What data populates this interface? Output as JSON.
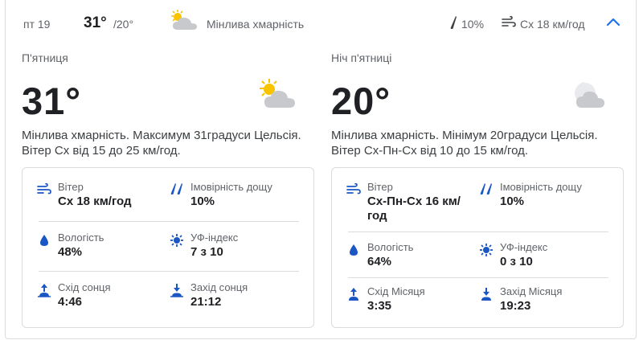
{
  "summary": {
    "day": "пт 19",
    "high": "31°",
    "low": "/20°",
    "condition": "Мінлива хмарність",
    "rain": "10%",
    "wind": "Сх 18 км/год"
  },
  "day": {
    "label": "П'ятниця",
    "temp": "31°",
    "description": "Мінлива хмарність. Максимум 31градуси Цельсія. Вітер Сх від 15 до 25 км/год.",
    "details": {
      "wind_label": "Вітер",
      "wind_value": "Сх 18 км/год",
      "rain_label": "Імовірність дощу",
      "rain_value": "10%",
      "humidity_label": "Вологість",
      "humidity_value": "48%",
      "uv_label": "УФ-індекс",
      "uv_value": "7 з 10",
      "rise_label": "Схід сонця",
      "rise_value": "4:46",
      "set_label": "Захід сонця",
      "set_value": "21:12"
    }
  },
  "night": {
    "label": "Ніч п'ятниці",
    "temp": "20°",
    "description": "Мінлива хмарність. Мінімум 20градуси Цельсія. Вітер Сх-Пн-Сх від 10 до 15 км/год.",
    "details": {
      "wind_label": "Вітер",
      "wind_value": "Сх-Пн-Сх 16 км/год",
      "rain_label": "Імовірність дощу",
      "rain_value": "10%",
      "humidity_label": "Вологість",
      "humidity_value": "64%",
      "uv_label": "УФ-індекс",
      "uv_value": "0 з 10",
      "rise_label": "Схід Місяця",
      "rise_value": "3:35",
      "set_label": "Захід Місяця",
      "set_value": "19:23"
    }
  },
  "colors": {
    "accent": "#1a73e8",
    "icon_blue": "#1a56c4",
    "sun": "#f9c300",
    "cloud": "#c7c9cc"
  }
}
